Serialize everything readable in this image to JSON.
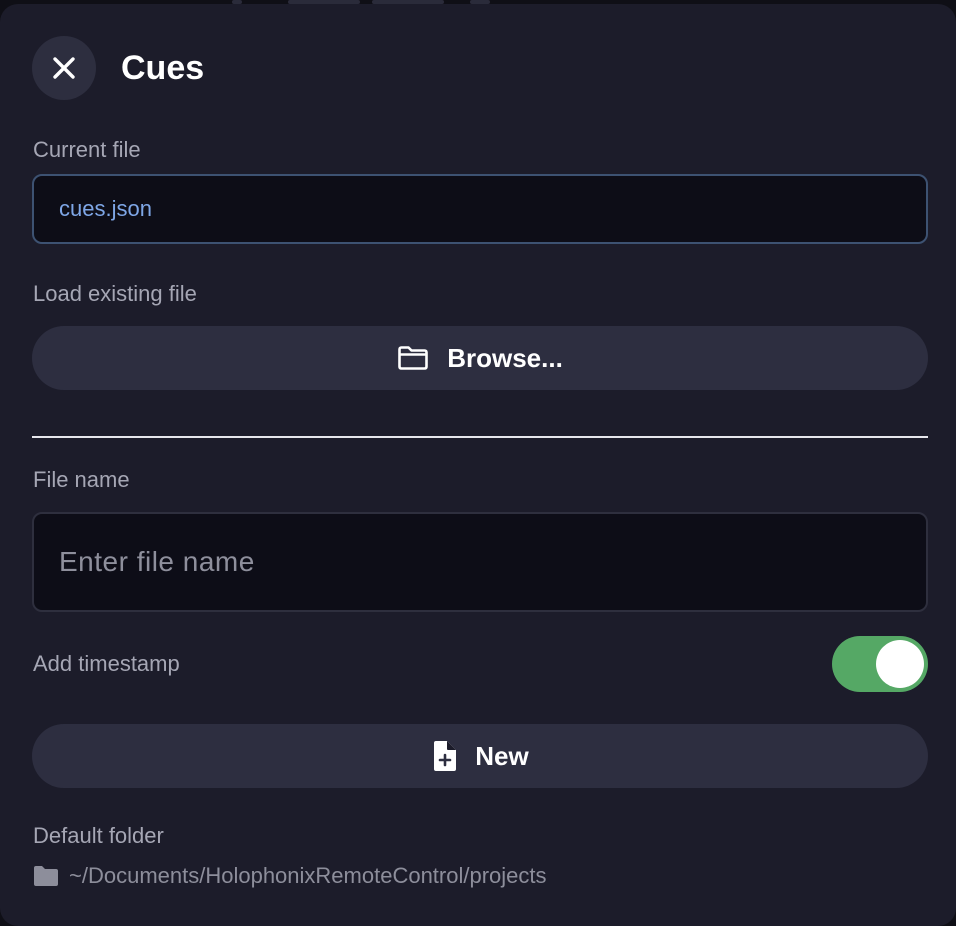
{
  "header": {
    "title": "Cues"
  },
  "current_file": {
    "label": "Current file",
    "value": "cues.json"
  },
  "load_existing": {
    "label": "Load existing file",
    "browse_label": "Browse..."
  },
  "new_file": {
    "name_label": "File name",
    "name_placeholder": "Enter file name",
    "name_value": "",
    "timestamp_label": "Add timestamp",
    "timestamp_enabled": true,
    "new_label": "New"
  },
  "default_folder": {
    "label": "Default folder",
    "path": "~/Documents/HolophonixRemoteControl/projects"
  },
  "icons": {
    "close": "close-icon",
    "browse": "folder-outline-icon",
    "new": "file-plus-icon",
    "folder": "folder-icon"
  },
  "colors": {
    "panel_bg": "#1c1c2a",
    "accent_text": "#7ea6e6",
    "toggle_on": "#55a865",
    "button_bg": "#2d2e40"
  }
}
